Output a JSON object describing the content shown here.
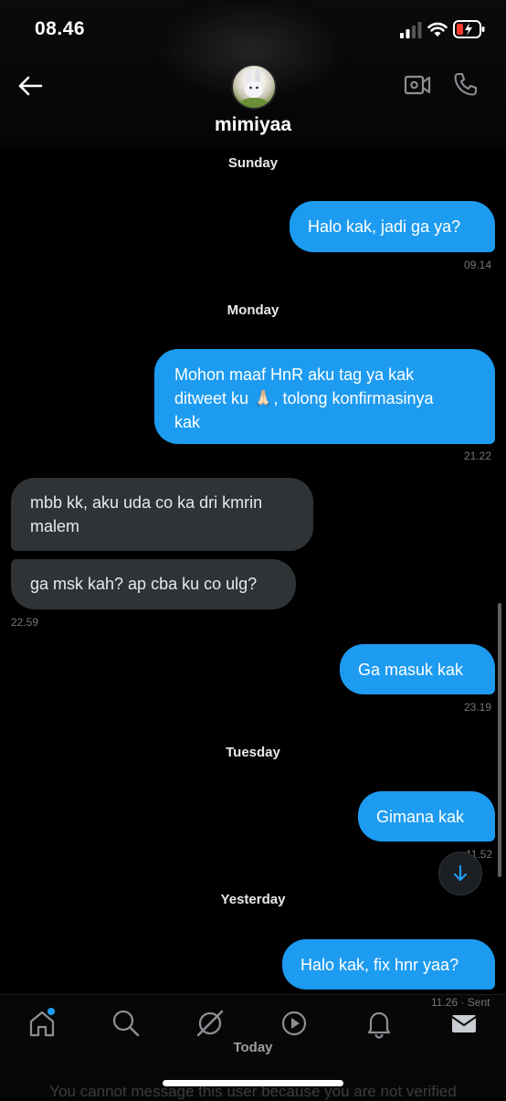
{
  "status_bar": {
    "time": "08.46"
  },
  "header": {
    "username": "mimiyaa"
  },
  "conversation": {
    "days": {
      "sunday": "Sunday",
      "monday": "Monday",
      "tuesday": "Tuesday",
      "yesterday": "Yesterday",
      "today": "Today"
    },
    "messages": [
      {
        "from": "me",
        "text": "Halo kak, jadi ga ya?",
        "time": "09.14"
      },
      {
        "from": "me",
        "text_line1": "Mohon maaf HnR aku tag ya kak",
        "text_line2": "ditweet ku 🙏🏻, tolong konfirmasinya",
        "text_line3": "kak",
        "time": "21.22"
      },
      {
        "from": "them",
        "text_line1": "mbb kk, aku uda co ka dri kmrin",
        "text_line2": "malem"
      },
      {
        "from": "them",
        "text": "ga msk kah? ap cba ku co ulg?",
        "time": "22.59"
      },
      {
        "from": "me",
        "text": "Ga masuk kak",
        "time": "23.19"
      },
      {
        "from": "me",
        "text": "Gimana kak",
        "time": "11.52"
      },
      {
        "from": "me",
        "text": "Halo kak, fix hnr yaa?",
        "time": "11.26 · Sent"
      }
    ]
  },
  "composer_notice": "You cannot message this user because you are not verified",
  "nav": {
    "items": [
      "home-icon",
      "search-icon",
      "grok-icon",
      "play-icon",
      "bell-icon",
      "mail-icon"
    ],
    "accent": "#1d9bf0"
  },
  "colors": {
    "outgoing_bubble": "#1d9bf0",
    "incoming_bubble": "#2f3336",
    "background": "#000000"
  }
}
